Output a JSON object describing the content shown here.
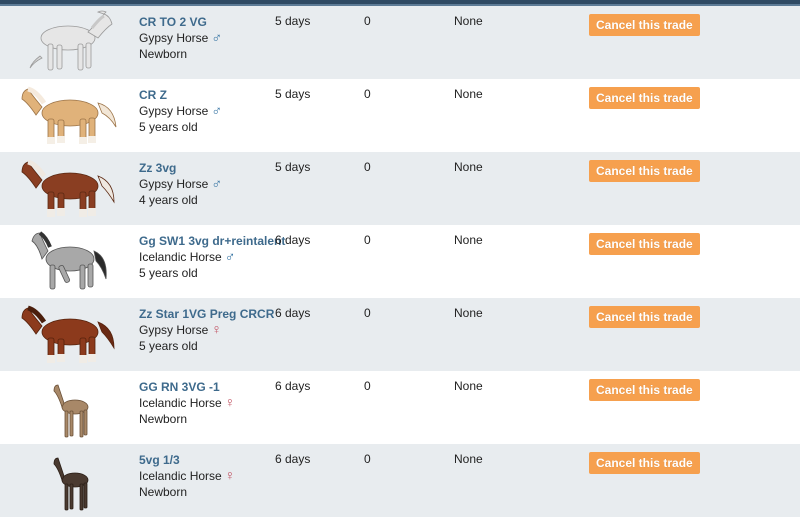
{
  "button_label": "Cancel this trade",
  "colors": {
    "name_link": "#3e6a8c",
    "button": "#f6a04e",
    "row_alt": "#e8ecef",
    "male": "#2f6fa0",
    "female": "#c05060"
  },
  "trades": [
    {
      "name": "CR TO 2 VG",
      "breed": "Gypsy Horse",
      "gender": "male",
      "gender_symbol": "♂",
      "age": "Newborn",
      "duration": "5 days",
      "offers": "0",
      "bid": "None",
      "coat": "white"
    },
    {
      "name": "CR Z",
      "breed": "Gypsy Horse",
      "gender": "male",
      "gender_symbol": "♂",
      "age": "5 years old",
      "duration": "5 days",
      "offers": "0",
      "bid": "None",
      "coat": "palomino"
    },
    {
      "name": "Zz 3vg",
      "breed": "Gypsy Horse",
      "gender": "male",
      "gender_symbol": "♂",
      "age": "4 years old",
      "duration": "5 days",
      "offers": "0",
      "bid": "None",
      "coat": "chestnut"
    },
    {
      "name": "Gg SW1 3vg dr+reintalent",
      "breed": "Icelandic Horse",
      "gender": "male",
      "gender_symbol": "♂",
      "age": "5 years old",
      "duration": "6 days",
      "offers": "0",
      "bid": "None",
      "coat": "grey"
    },
    {
      "name": "Zz Star 1VG Preg CRCR",
      "breed": "Gypsy Horse",
      "gender": "female",
      "gender_symbol": "♀",
      "age": "5 years old",
      "duration": "6 days",
      "offers": "0",
      "bid": "None",
      "coat": "bay"
    },
    {
      "name": "GG RN 3VG -1",
      "breed": "Icelandic Horse",
      "gender": "female",
      "gender_symbol": "♀",
      "age": "Newborn",
      "duration": "6 days",
      "offers": "0",
      "bid": "None",
      "coat": "dun-foal"
    },
    {
      "name": "5vg 1/3",
      "breed": "Icelandic Horse",
      "gender": "female",
      "gender_symbol": "♀",
      "age": "Newborn",
      "duration": "6 days",
      "offers": "0",
      "bid": "None",
      "coat": "dark-foal"
    }
  ]
}
